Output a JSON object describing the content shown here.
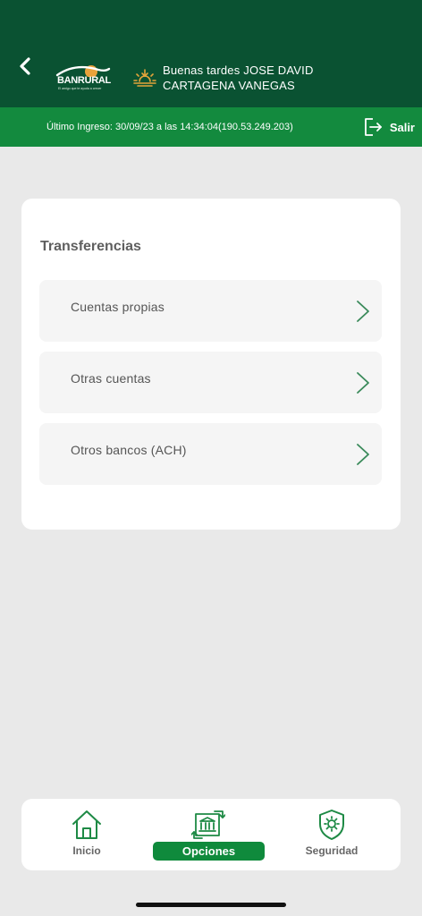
{
  "header": {
    "logo": {
      "brand": "BANRURAL",
      "tagline": "El amigo que te ayuda a crecer"
    },
    "greeting": {
      "line1": "Buenas tardes JOSE DAVID",
      "line2": "CARTAGENA VANEGAS"
    }
  },
  "status_bar": {
    "last_login": "Último Ingreso: 30/09/23 a las 14:34:04(190.53.249.203)",
    "logout_label": "Salir"
  },
  "main": {
    "title": "Transferencias",
    "options": [
      {
        "label": "Cuentas propias"
      },
      {
        "label": "Otras cuentas"
      },
      {
        "label": "Otros bancos (ACH)"
      }
    ]
  },
  "bottom_nav": {
    "items": [
      {
        "label": "Inicio",
        "icon": "home-icon"
      },
      {
        "label": "Opciones",
        "icon": "bank-transfer-icon",
        "active": true
      },
      {
        "label": "Seguridad",
        "icon": "shield-gear-icon"
      }
    ]
  },
  "colors": {
    "header_bg": "#0a5232",
    "status_bar_bg": "#138a3e",
    "accent_green": "#0f8a3c",
    "chevron_green": "#3a8a5a",
    "page_bg": "#e9e9e9"
  }
}
